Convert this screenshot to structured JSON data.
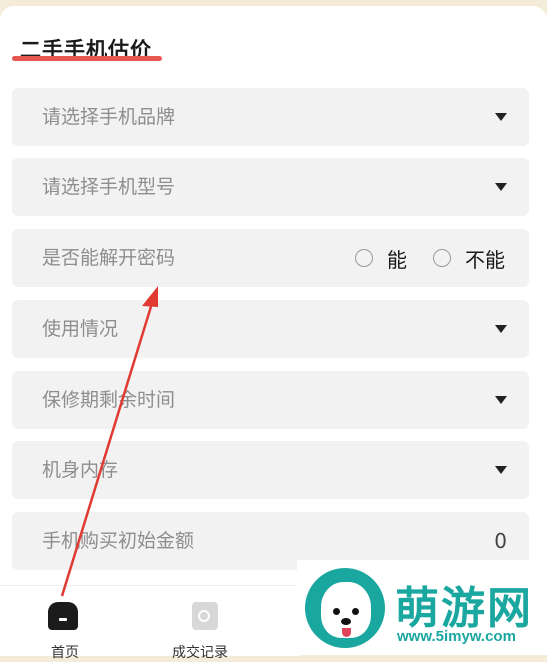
{
  "page_title": "二手手机估价",
  "form": {
    "brand_placeholder": "请选择手机品牌",
    "model_placeholder": "请选择手机型号",
    "password_question": "是否能解开密码",
    "password_options": [
      "能",
      "不能"
    ],
    "usage_placeholder": "使用情况",
    "warranty_placeholder": "保修期剩余时间",
    "storage_placeholder": "机身内存",
    "price_label": "手机购买初始金额",
    "price_value": "0"
  },
  "tabbar": {
    "home_label": "首页",
    "records_label": "成交记录"
  },
  "watermark": {
    "brand": "萌游网",
    "url": "www.5imyw.com"
  },
  "colors": {
    "accent_underline": "#e8574f",
    "annotation_arrow": "#e03a32",
    "watermark": "#19a7a0"
  }
}
